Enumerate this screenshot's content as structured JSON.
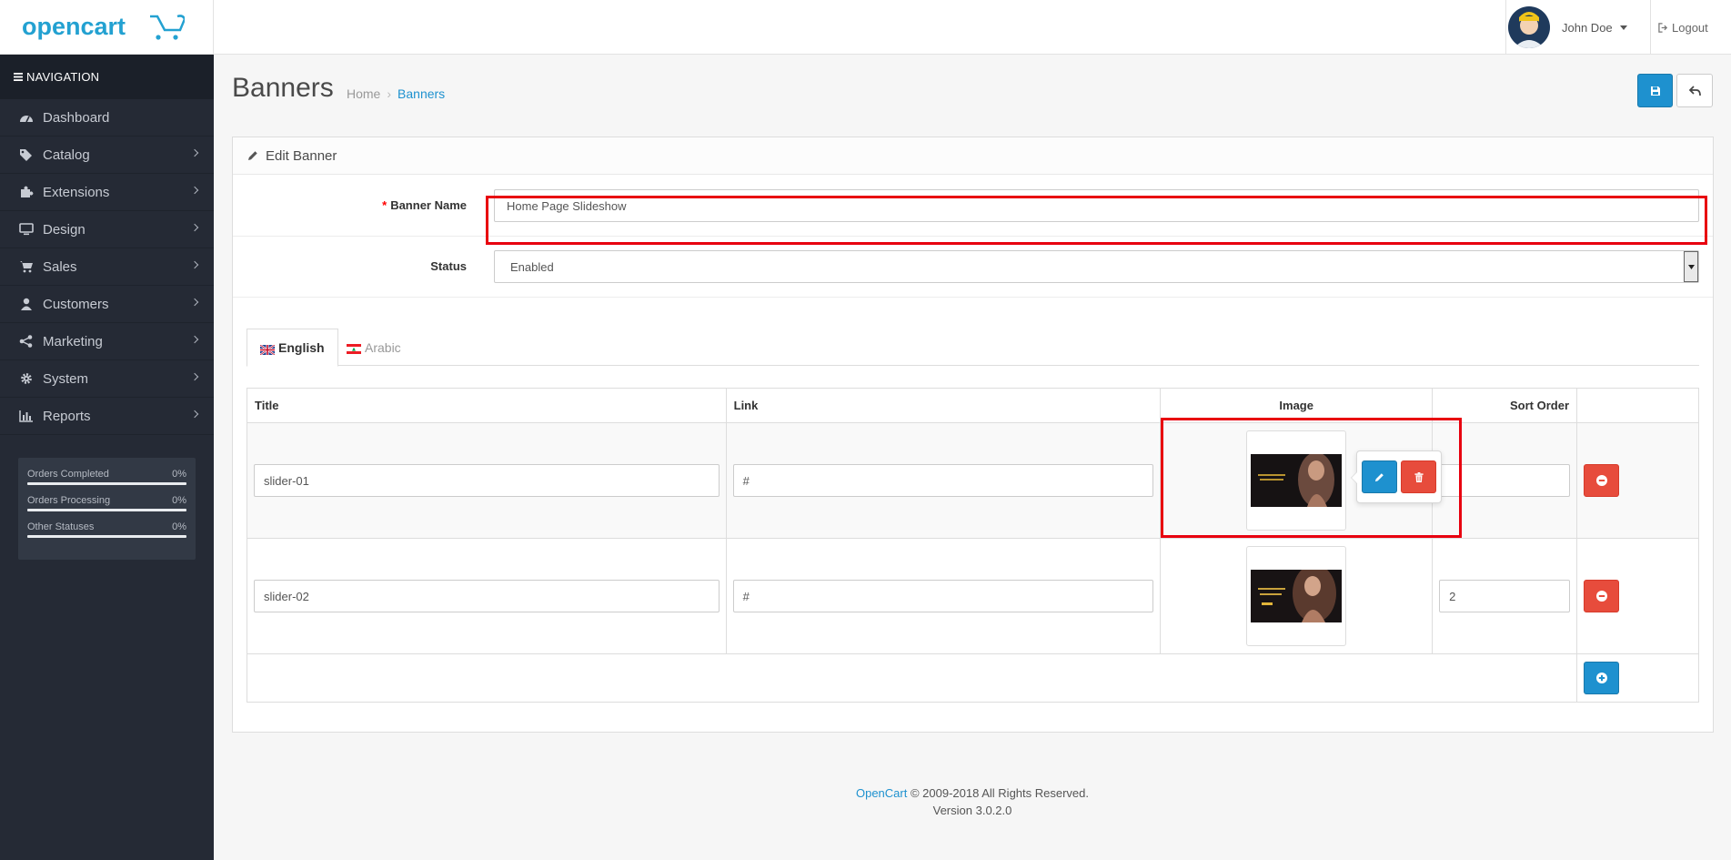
{
  "header": {
    "logo_text": "opencart",
    "user_name": "John Doe",
    "logout_label": "Logout"
  },
  "sidebar": {
    "nav_title": "NAVIGATION",
    "items": [
      {
        "label": "Dashboard",
        "icon": "dashboard-icon"
      },
      {
        "label": "Catalog",
        "icon": "tags-icon"
      },
      {
        "label": "Extensions",
        "icon": "puzzle-icon"
      },
      {
        "label": "Design",
        "icon": "monitor-icon"
      },
      {
        "label": "Sales",
        "icon": "cart-icon"
      },
      {
        "label": "Customers",
        "icon": "user-icon"
      },
      {
        "label": "Marketing",
        "icon": "share-icon"
      },
      {
        "label": "System",
        "icon": "gear-icon"
      },
      {
        "label": "Reports",
        "icon": "bar-chart-icon"
      }
    ],
    "stats": [
      {
        "label": "Orders Completed",
        "value": "0%"
      },
      {
        "label": "Orders Processing",
        "value": "0%"
      },
      {
        "label": "Other Statuses",
        "value": "0%"
      }
    ]
  },
  "page": {
    "title": "Banners",
    "breadcrumb": [
      "Home",
      "Banners"
    ]
  },
  "panel": {
    "heading": "Edit Banner",
    "banner_name_label": "Banner Name",
    "banner_name_value": "Home Page Slideshow",
    "status_label": "Status",
    "status_value": "Enabled",
    "tabs": [
      "English",
      "Arabic"
    ],
    "table": {
      "headers": [
        "Title",
        "Link",
        "Image",
        "Sort Order"
      ],
      "rows": [
        {
          "title": "slider-01",
          "link": "#",
          "sort_order": "",
          "thumb_text": "Lingerie Shop"
        },
        {
          "title": "slider-02",
          "link": "#",
          "sort_order": "2",
          "thumb_text": "Digital Lingerie Shop"
        }
      ]
    }
  },
  "footer": {
    "brand": "OpenCart",
    "copyright": "© 2009-2018 All Rights Reserved.",
    "version": "Version 3.0.2.0"
  },
  "colors": {
    "primary": "#1e91cf",
    "danger": "#e74c3c",
    "sidebar": "#252a35",
    "highlight": "#e8000f"
  }
}
